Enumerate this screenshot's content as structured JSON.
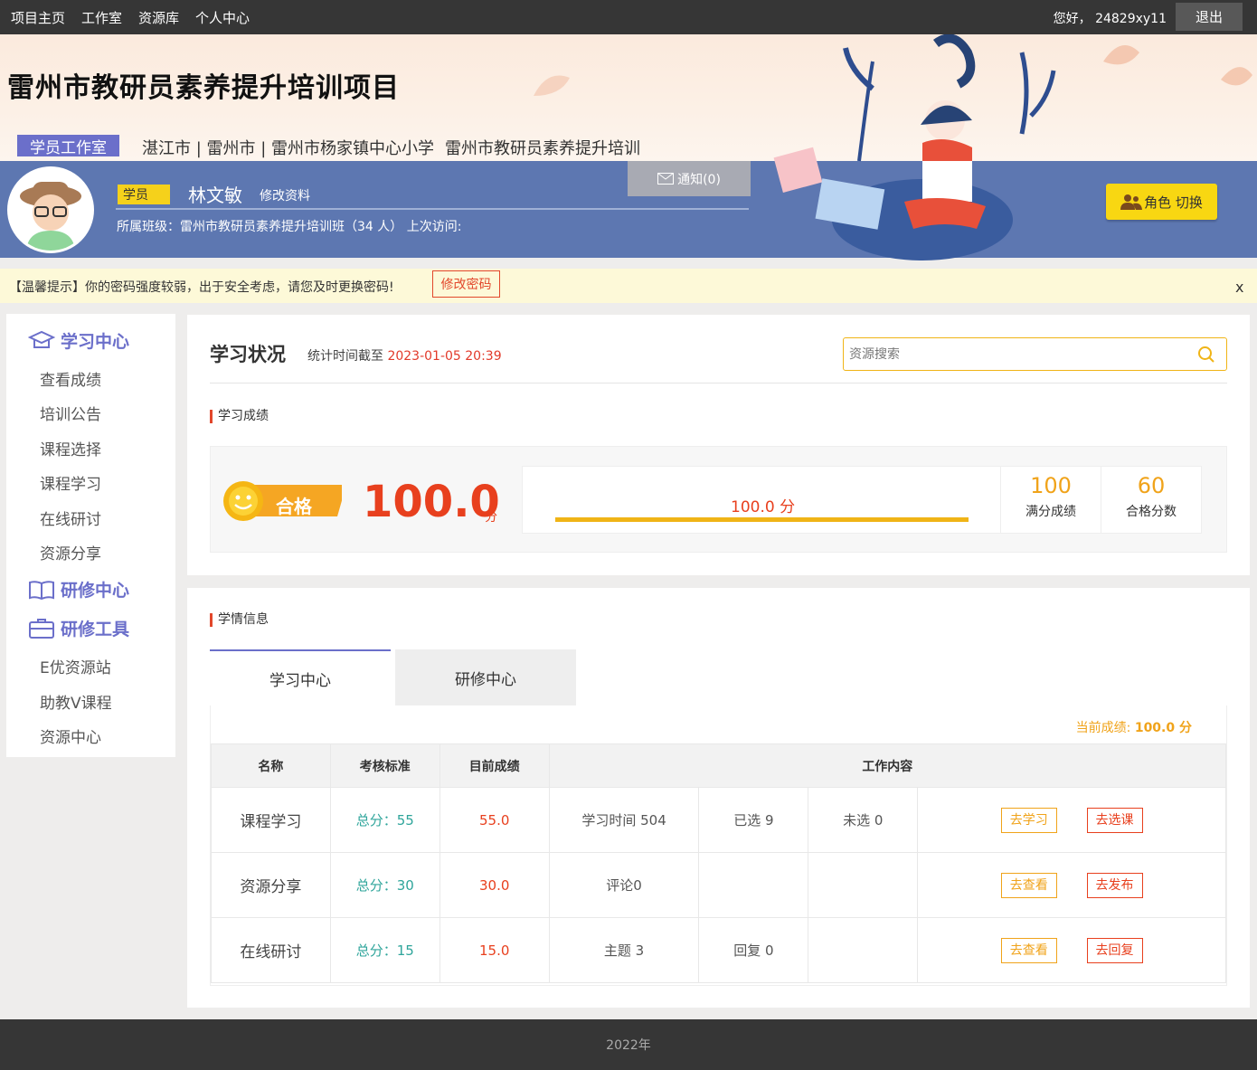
{
  "topnav": {
    "links": [
      "项目主页",
      "工作室",
      "资源库",
      "个人中心"
    ],
    "greeting": "您好， 24829xy11",
    "logout": "退出"
  },
  "banner": {
    "title": "雷州市教研员素养提升培训项目",
    "tag": "学员工作室",
    "location": "湛江市 | 雷州市 | 雷州市杨家镇中心小学",
    "project": "雷州市教研员素养提升培训"
  },
  "user": {
    "role": "学员",
    "name": "林文敏",
    "edit_profile": "修改资料",
    "class_info": "所属班级：雷州市教研员素养提升培训班（34 人） 上次访问:",
    "notice": "通知(0)",
    "role_switch": "角色 切换"
  },
  "tip": {
    "text": "【温馨提示】你的密码强度较弱，出于安全考虑，请您及时更换密码!",
    "button": "修改密码",
    "close": "x"
  },
  "sidebar": {
    "sections": [
      {
        "title": "学习中心",
        "icon": "learning-center-icon",
        "items": [
          "查看成绩",
          "培训公告",
          "课程选择",
          "课程学习",
          "在线研讨",
          "资源分享"
        ]
      },
      {
        "title": "研修中心",
        "icon": "book-icon",
        "items": []
      },
      {
        "title": "研修工具",
        "icon": "toolbox-icon",
        "items": [
          "E优资源站",
          "助教V课程",
          "资源中心"
        ]
      }
    ]
  },
  "status": {
    "title": "学习状况",
    "stat_time_label": "统计时间截至",
    "stat_time": "2023-01-05 20:39",
    "search_placeholder": "资源搜索",
    "grade_section": "学习成绩",
    "pass_label": "合格",
    "score": "100.0",
    "score_unit": "分",
    "progress_text": "100.0 分",
    "progress_fraction": 1.0,
    "full_score": "100",
    "full_score_label": "满分成绩",
    "pass_score": "60",
    "pass_score_label": "合格分数"
  },
  "info": {
    "section": "学情信息",
    "tabs": [
      "学习中心",
      "研修中心"
    ],
    "current_label": "当前成绩:",
    "current_value": "100.0 分",
    "headers": [
      "名称",
      "考核标准",
      "目前成绩",
      "工作内容"
    ],
    "rows": [
      {
        "name": "课程学习",
        "std": "总分：55",
        "score": "55.0",
        "c1": "学习时间 504",
        "c2": "已选 9",
        "c3": "未选 0",
        "b1": "去学习",
        "b2": "去选课"
      },
      {
        "name": "资源分享",
        "std": "总分：30",
        "score": "30.0",
        "c1": "评论0",
        "c2": "",
        "c3": "",
        "b1": "去查看",
        "b2": "去发布"
      },
      {
        "name": "在线研讨",
        "std": "总分：15",
        "score": "15.0",
        "c1": "主题 3",
        "c2": "回复 0",
        "c3": "",
        "b1": "去查看",
        "b2": "去回复"
      }
    ]
  },
  "footer": {
    "text": "2022年"
  },
  "colors": {
    "accent": "#6b6fca",
    "topbar": "#363636",
    "userbar": "#5d77b1",
    "orange": "#f0a31a",
    "red": "#e8401e",
    "yellow": "#f5d11b"
  }
}
